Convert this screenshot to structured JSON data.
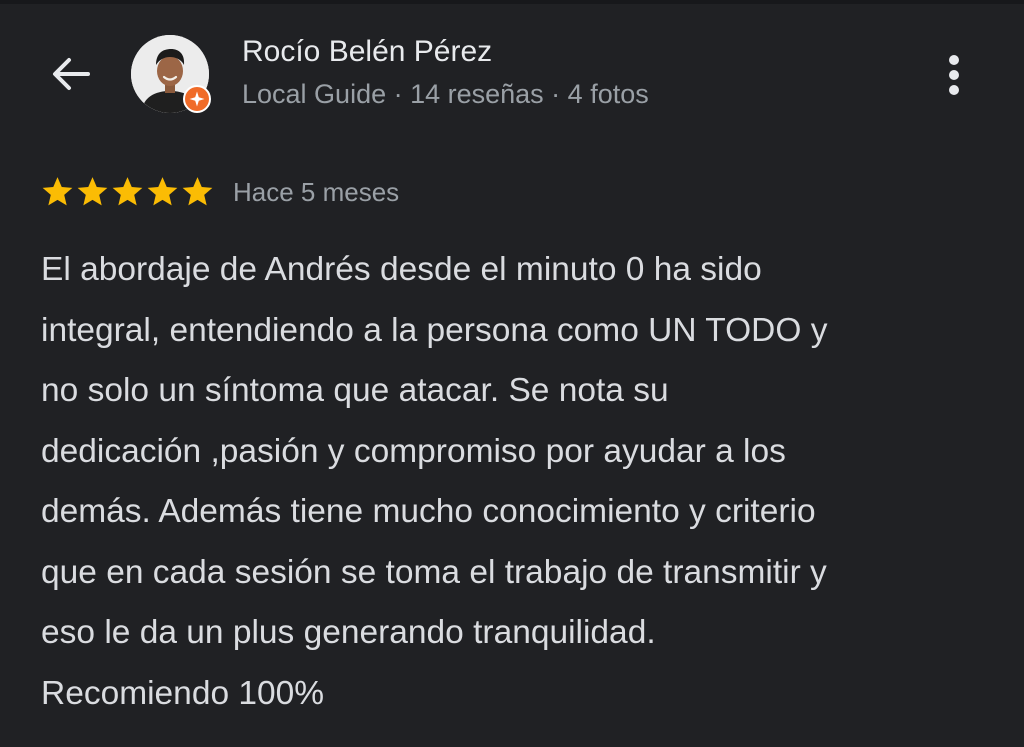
{
  "header": {
    "back_icon": "arrow-back-icon",
    "author_name": "Rocío Belén Pérez",
    "author_meta": "Local Guide · 14 reseñas · 4 fotos",
    "badge_icon": "local-guide-badge-icon",
    "more_icon": "more-vert-icon"
  },
  "review": {
    "rating": 5,
    "rating_max": 5,
    "date": "Hace 5 meses",
    "text_lines": [
      "El abordaje de Andrés desde el minuto 0 ha sido",
      "integral, entendiendo a la persona como UN TODO y",
      "no solo un síntoma que atacar. Se nota su",
      "dedicación ,pasión y compromiso por ayudar a los",
      "demás. Además tiene mucho conocimiento y criterio",
      "que en cada sesión se toma el trabajo de transmitir y",
      "eso le da un plus generando tranquilidad.",
      "Recomiendo 100%"
    ]
  },
  "colors": {
    "background": "#202124",
    "star": "#fbbc04",
    "badge": "#f06b28",
    "text_primary": "#e8eaed",
    "text_secondary": "#9aa0a6"
  }
}
